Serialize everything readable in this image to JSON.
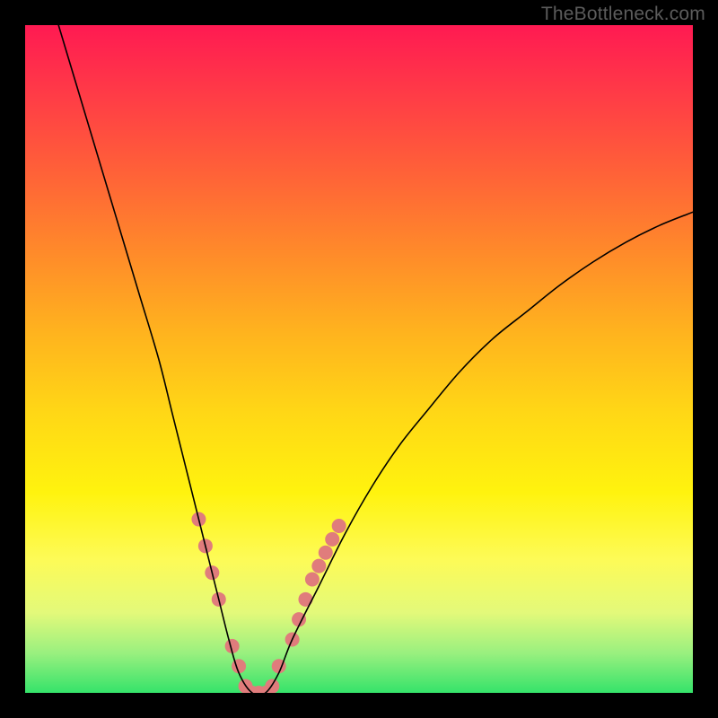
{
  "watermark": "TheBottleneck.com",
  "chart_data": {
    "type": "line",
    "title": "",
    "xlabel": "",
    "ylabel": "",
    "xlim": [
      0,
      100
    ],
    "ylim": [
      0,
      100
    ],
    "grid": false,
    "legend": false,
    "series": [
      {
        "name": "bottleneck-curve",
        "x": [
          5,
          8,
          11,
          14,
          17,
          20,
          22,
          24,
          26,
          27.5,
          29,
          30.5,
          32,
          34,
          36,
          38,
          40,
          44,
          48,
          52,
          56,
          60,
          65,
          70,
          75,
          80,
          85,
          90,
          95,
          100
        ],
        "y": [
          100,
          90,
          80,
          70,
          60,
          50,
          42,
          34,
          26,
          20,
          14,
          8,
          3,
          0,
          0,
          3,
          8,
          16,
          24,
          31,
          37,
          42,
          48,
          53,
          57,
          61,
          64.5,
          67.5,
          70,
          72
        ],
        "color": "#000000"
      }
    ],
    "markers": {
      "name": "highlight-dots",
      "color": "#e07c7c",
      "radius_px": 8,
      "points": [
        {
          "x": 26,
          "y": 26
        },
        {
          "x": 27,
          "y": 22
        },
        {
          "x": 28,
          "y": 18
        },
        {
          "x": 29,
          "y": 14
        },
        {
          "x": 31,
          "y": 7
        },
        {
          "x": 32,
          "y": 4
        },
        {
          "x": 33,
          "y": 1
        },
        {
          "x": 34,
          "y": 0
        },
        {
          "x": 35,
          "y": 0
        },
        {
          "x": 36,
          "y": 0
        },
        {
          "x": 37,
          "y": 1
        },
        {
          "x": 38,
          "y": 4
        },
        {
          "x": 40,
          "y": 8
        },
        {
          "x": 41,
          "y": 11
        },
        {
          "x": 42,
          "y": 14
        },
        {
          "x": 43,
          "y": 17
        },
        {
          "x": 44,
          "y": 19
        },
        {
          "x": 45,
          "y": 21
        },
        {
          "x": 46,
          "y": 23
        },
        {
          "x": 47,
          "y": 25
        }
      ]
    },
    "background_gradient": {
      "top_color": "#ff1a52",
      "bottom_color": "#35e36a"
    }
  }
}
